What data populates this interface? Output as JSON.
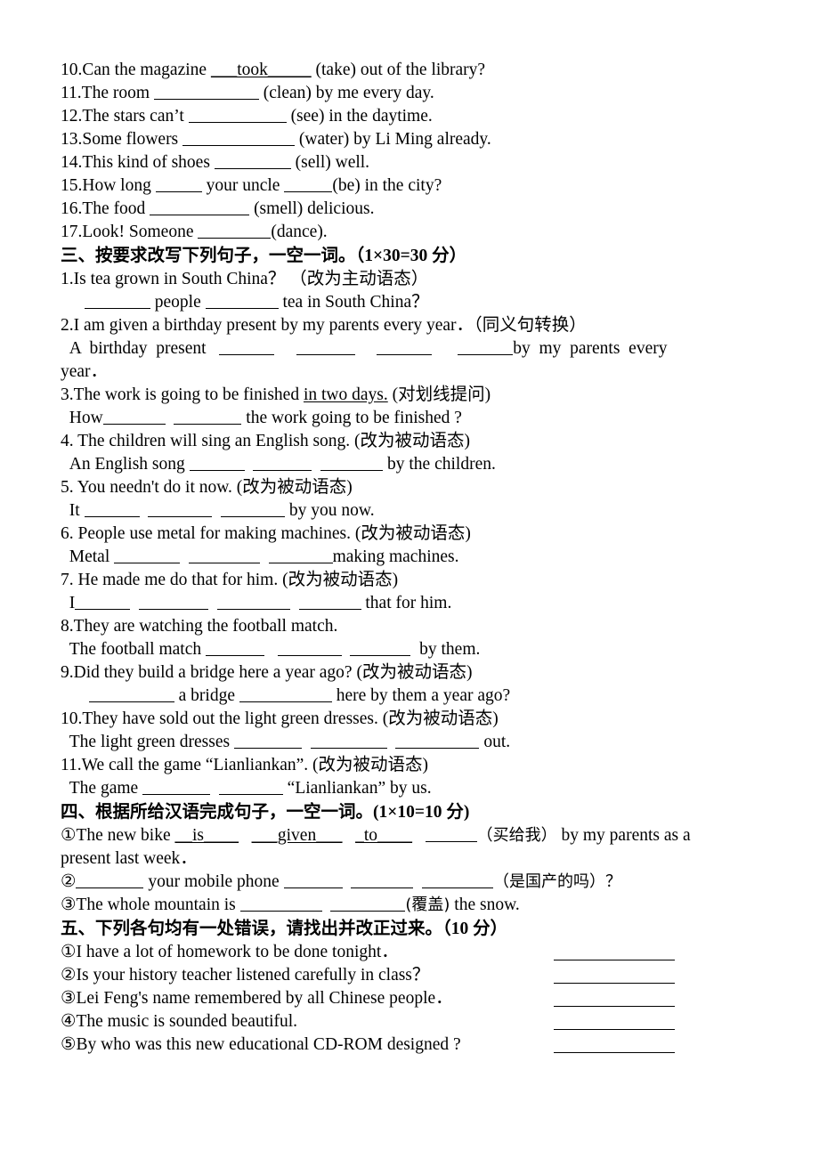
{
  "document": {
    "type": "worksheet",
    "language": "en-zh",
    "section2_tail": {
      "items": [
        {
          "no": "10.",
          "pre": "Can the magazine ",
          "blank1": "___took_____",
          "post": " (take) out of the library?"
        },
        {
          "no": "11.",
          "pre": "The room ",
          "blank_w": 118,
          "post": " (clean) by me every day."
        },
        {
          "no": "12.",
          "pre": "The stars can’t ",
          "blank_w": 110,
          "post": " (see) in the daytime."
        },
        {
          "no": "13.",
          "pre": "Some flowers ",
          "blank_w": 126,
          "post": " (water) by Li Ming already."
        },
        {
          "no": "14.",
          "pre": "This kind of shoes ",
          "blank_w": 86,
          "post": " (sell) well."
        },
        {
          "no": "15.",
          "pre": "How long ",
          "blank_w": 52,
          "mid": " your uncle ",
          "blank2_w": 54,
          "post": "(be) in the city?"
        },
        {
          "no": "16.",
          "pre": "The food ",
          "blank_w": 112,
          "post": " (smell) delicious."
        },
        {
          "no": "17.",
          "pre": "Look! Someone ",
          "blank_w": 82,
          "post": "(dance)."
        }
      ]
    },
    "section3": {
      "heading": "三、按要求改写下列句子，一空一词。",
      "score": "（1×30=30 分）",
      "items": [
        {
          "no": "1.",
          "prompt": "Is tea grown in South China？ （改为主动语态）",
          "answer_pre": " ",
          "b1": 74,
          "mid1": " people ",
          "b2": 82,
          "tail": " tea in South China？"
        },
        {
          "no": "2.",
          "prompt": "I am given a birthday present by my parents every year．（同义句转换）",
          "answer_line1_pre": "  A  birthday  present   ",
          "b1": 62,
          "g1": "     ",
          "b2": 66,
          "g2": "     ",
          "b3": 62,
          "g3": "      ",
          "b4": 62,
          "answer_line1_tail": "by  my  parents  every",
          "answer_line2": "year．"
        },
        {
          "no": "3.",
          "prompt_a": "The work is going to be finished ",
          "prompt_u": "in two days.",
          "prompt_b": " (对划线提问)",
          "answer_pre": "  How",
          "b1": 70,
          "gap": "  ",
          "b2": 76,
          "tail": " the work going to be finished ?"
        },
        {
          "no": "4.",
          "prompt": "The children will sing an English song. (改为被动语态)",
          "answer_pre": "  An English song ",
          "b1": 62,
          "g1": "  ",
          "b2": 66,
          "g2": "  ",
          "b3": 70,
          "tail": " by the children."
        },
        {
          "no": "5.",
          "prompt": "You needn't do it now. (改为被动语态)",
          "answer_pre": "  It ",
          "b1": 62,
          "g1": "  ",
          "b2": 72,
          "g2": "  ",
          "b3": 72,
          "tail": " by you now."
        },
        {
          "no": "6.",
          "prompt": "People use metal for making machines. (改为被动语态)",
          "answer_pre": "  Metal ",
          "b1": 74,
          "g1": "  ",
          "b2": 80,
          "g2": "  ",
          "b3": 72,
          "tail": "making machines."
        },
        {
          "no": "7.",
          "prompt": "He made me do that for him. (改为被动语态)",
          "answer_pre": "  I",
          "b1": 62,
          "g1": "  ",
          "b2": 78,
          "g2": "  ",
          "b3": 82,
          "g3": "  ",
          "b4": 70,
          "tail": " that for him."
        },
        {
          "no": "8.",
          "prompt": "They are watching the football match.",
          "answer_pre": "  The football match ",
          "b1": 66,
          "g1": "   ",
          "b2": 72,
          "g2": "  ",
          "b3": 68,
          "tail": "  by them."
        },
        {
          "no": "9.",
          "prompt": "Did they build a bridge here a year ago? (改为被动语态)",
          "answer_pre": "  ",
          "b1": 96,
          "g1": " a bridge ",
          "b2": 104,
          "tail": " here by them a year ago?"
        },
        {
          "no": "10.",
          "prompt": "They have sold out the light green dresses. (改为被动语态)",
          "answer_pre": "  The light green dresses ",
          "b1": 76,
          "g1": "  ",
          "b2": 86,
          "g2": "  ",
          "b3": 94,
          "tail": " out."
        },
        {
          "no": "11.",
          "prompt": "We call the game “Lianliankan”. (改为被动语态)",
          "answer_pre": "  The game ",
          "b1": 76,
          "g1": "  ",
          "b2": 72,
          "tail": " “Lianliankan” by us."
        }
      ]
    },
    "section4": {
      "heading": "四、根据所给汉语完成句子，一空一词。",
      "score": "(1×10=10 分)",
      "items": [
        {
          "no": "①",
          "pre": "The new bike ",
          "f1": "__is____",
          "g1": "   ",
          "f2": "___given___",
          "g2": "   ",
          "f3": "_to____",
          "g3": "   ",
          "b4": 58,
          "hint": "（买给我）",
          "tail": " by my parents as a",
          "line2": "present last week．"
        },
        {
          "no": "②",
          "pre": "",
          "b1": 76,
          "mid": " your mobile phone ",
          "b2": 66,
          "g1": "  ",
          "b3": 70,
          "g2": "  ",
          "b4": 80,
          "hint": "（是国产的吗）？"
        },
        {
          "no": "③",
          "pre": "The whole mountain is ",
          "b1": 92,
          "g1": "  ",
          "b2": 84,
          "hint": "(覆盖)",
          "tail": " the snow."
        }
      ]
    },
    "section5": {
      "heading": "五、下列各句均有一处错误，请找出并改正过来。",
      "score": "（10 分）",
      "items": [
        {
          "no": "①",
          "text": "I have a lot of homework to be done tonight．"
        },
        {
          "no": "②",
          "text": "Is your history teacher listened carefully in class？"
        },
        {
          "no": "③",
          "text": "Lei Feng's name remembered by all Chinese people．"
        },
        {
          "no": "④",
          "text": "The music is sounded beautiful."
        },
        {
          "no": "⑤",
          "text": "By who was this new educational CD-ROM designed ?"
        }
      ]
    }
  }
}
